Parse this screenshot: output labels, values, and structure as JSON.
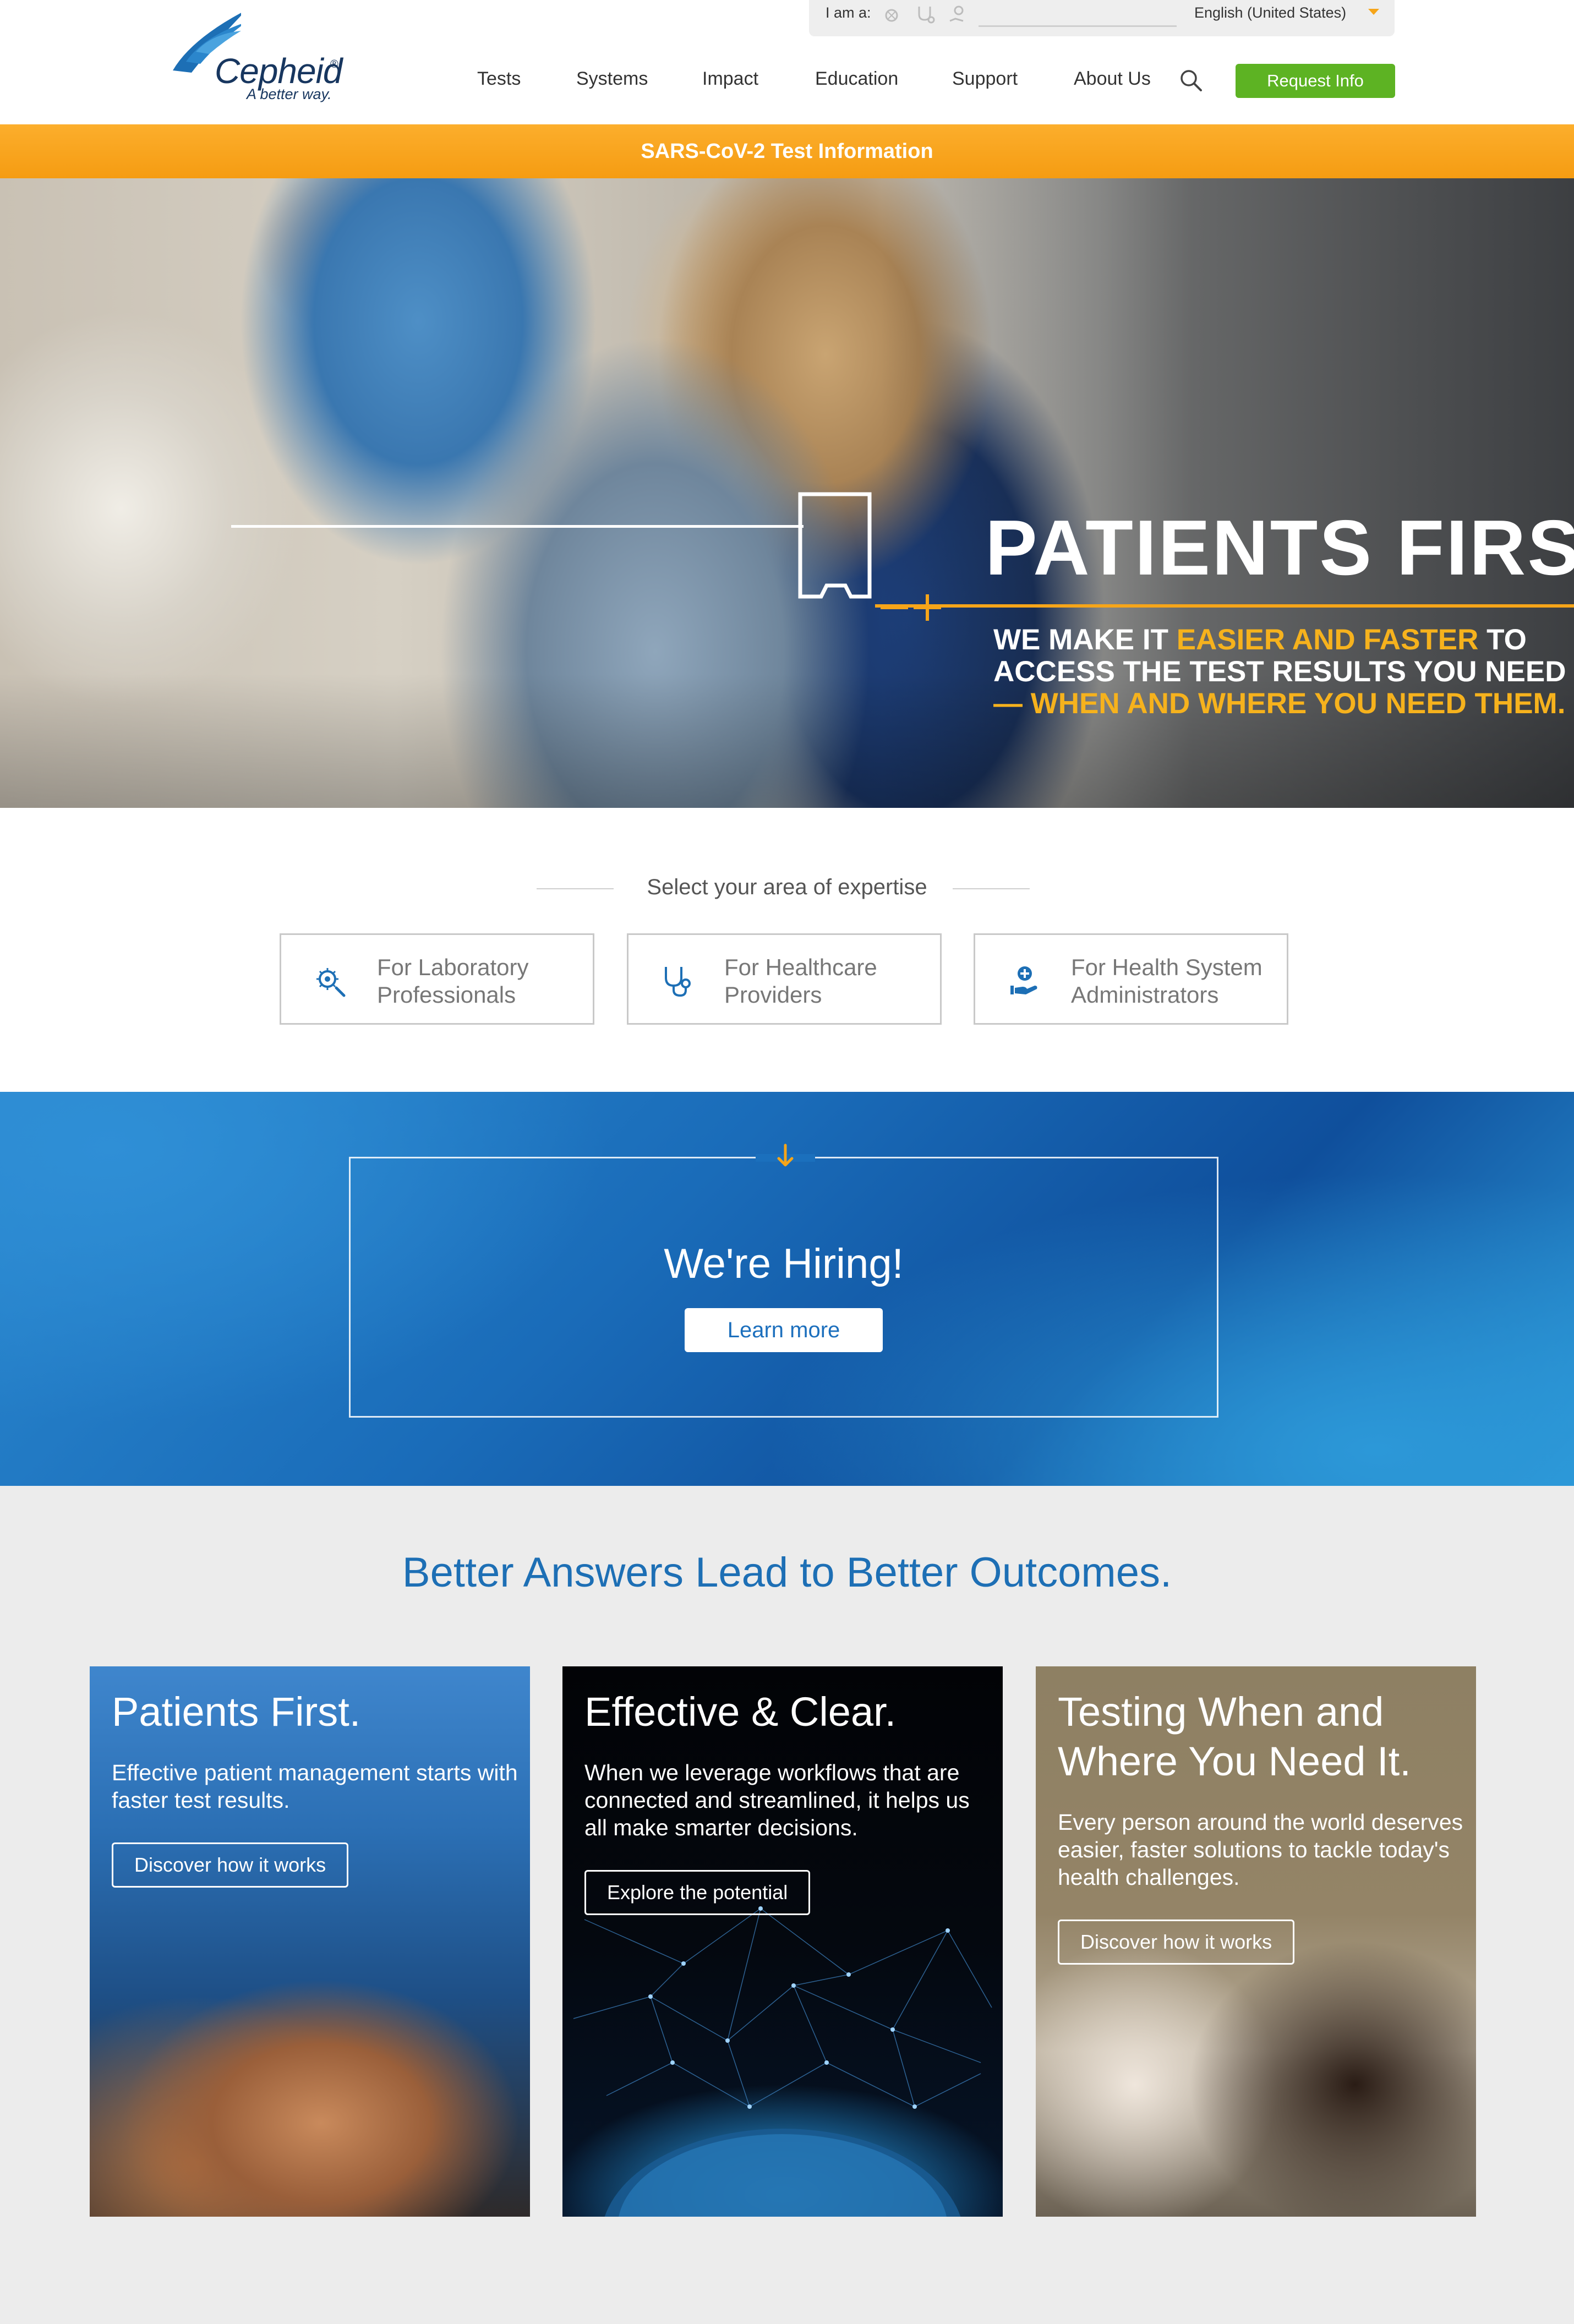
{
  "utility": {
    "iam_label": "I am a:",
    "language": "English (United States)"
  },
  "logo": {
    "name": "Cepheid",
    "reg": "®",
    "tagline": "A better way."
  },
  "nav": {
    "items": [
      "Tests",
      "Systems",
      "Impact",
      "Education",
      "Support",
      "About Us"
    ],
    "request_label": "Request Info"
  },
  "covid_banner": "SARS-CoV-2 Test Information",
  "hero": {
    "title": "PATIENTS FIRST",
    "title_dot": ".",
    "line1_a": "WE MAKE IT ",
    "line1_b": "EASIER AND FASTER",
    "line1_c": " TO",
    "line2": "ACCESS THE TEST RESULTS YOU NEED",
    "line3": "— WHEN AND WHERE YOU NEED THEM."
  },
  "expertise": {
    "label": "Select your area of expertise",
    "cards": [
      {
        "line1": "For Laboratory",
        "line2": "Professionals",
        "icon": "microscope-virus-icon"
      },
      {
        "line1": "For Healthcare",
        "line2": "Providers",
        "icon": "stethoscope-icon"
      },
      {
        "line1": "For Health System",
        "line2": "Administrators",
        "icon": "hand-plus-icon"
      }
    ]
  },
  "hiring": {
    "title": "We're Hiring!",
    "button": "Learn more"
  },
  "outcomes": {
    "title": "Better Answers Lead to Better Outcomes.",
    "cards": [
      {
        "title1": "Patients First.",
        "title2": "",
        "desc1": "Effective patient management starts with",
        "desc2": "faster test results.",
        "desc3": "",
        "button": "Discover how it works"
      },
      {
        "title1": "Effective & Clear.",
        "title2": "",
        "desc1": "When we leverage workflows that are",
        "desc2": "connected and streamlined, it helps us",
        "desc3": "all make smarter decisions.",
        "button": "Explore the potential"
      },
      {
        "title1": "Testing When and",
        "title2": "Where You Need It.",
        "desc1": "Every person around the world deserves",
        "desc2": "easier, faster solutions to tackle today's",
        "desc3": "health challenges.",
        "button": "Discover how it works"
      }
    ]
  },
  "colors": {
    "brand_navy": "#17365f",
    "accent_orange": "#f6a519",
    "cta_green": "#5db323",
    "link_blue": "#1d6fb5"
  }
}
